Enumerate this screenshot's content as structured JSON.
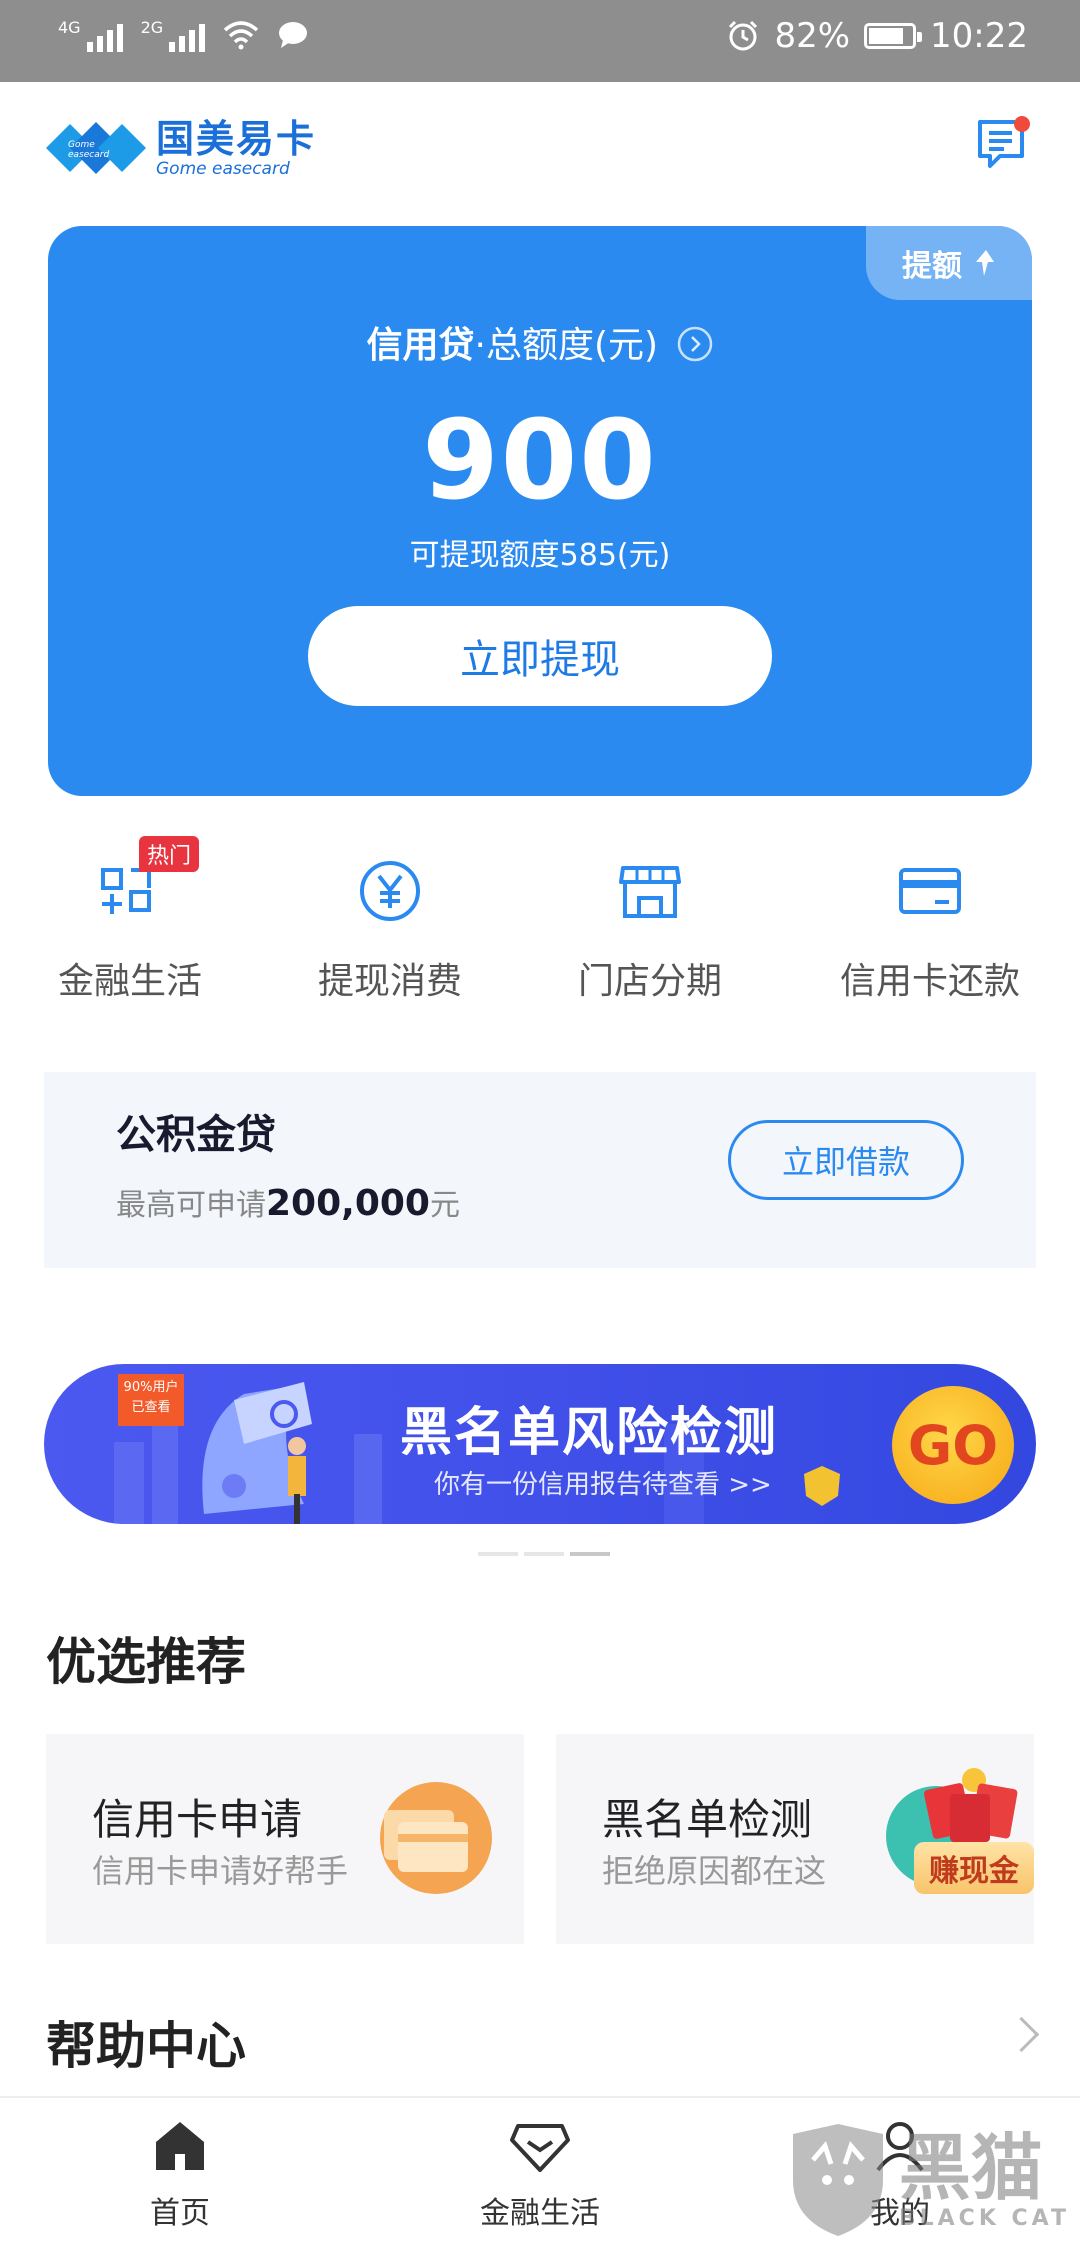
{
  "status_bar": {
    "net1": "4G",
    "net2": "2G",
    "battery_percent": "82%",
    "battery_level": 0.82,
    "time": "10:22"
  },
  "header": {
    "logo_cn": "国美易卡",
    "logo_en": "Gome easecard",
    "logo_small": "Gome easecard"
  },
  "credit_card": {
    "raise_label": "提额",
    "title_bold": "信用贷",
    "title_rest": "·总额度(元)",
    "amount": "900",
    "available": "可提现额度585(元)",
    "button": "立即提现"
  },
  "quick_menu": [
    {
      "label": "金融生活",
      "badge": "热门",
      "icon": "grid-icon"
    },
    {
      "label": "提现消费",
      "icon": "yuan-icon"
    },
    {
      "label": "门店分期",
      "icon": "store-icon"
    },
    {
      "label": "信用卡还款",
      "icon": "card-icon"
    }
  ],
  "fund_loan": {
    "title": "公积金贷",
    "sub_prefix": "最高可申请",
    "amount": "200,000",
    "unit": "元",
    "button": "立即借款"
  },
  "banner": {
    "badge_line1": "90%用户",
    "badge_line2": "已查看",
    "title": "黑名单风险检测",
    "subtitle": "你有一份信用报告待查看 >>",
    "go": "GO"
  },
  "recommend": {
    "title": "优选推荐",
    "cards": [
      {
        "title": "信用卡申请",
        "subtitle": "信用卡申请好帮手"
      },
      {
        "title": "黑名单检测",
        "subtitle": "拒绝原因都在这",
        "badge": "赚现金"
      }
    ]
  },
  "help": {
    "title": "帮助中心"
  },
  "bottom_nav": [
    {
      "label": "首页"
    },
    {
      "label": "金融生活"
    },
    {
      "label": "我的"
    }
  ],
  "watermark": {
    "cn": "黑猫",
    "en": "BLACK CAT"
  },
  "colors": {
    "primary": "#2b8af0",
    "card_bg": "#2b8af0",
    "hot_badge": "#e8343f",
    "banner": "#4252e8",
    "go_button": "#f8b21e"
  }
}
